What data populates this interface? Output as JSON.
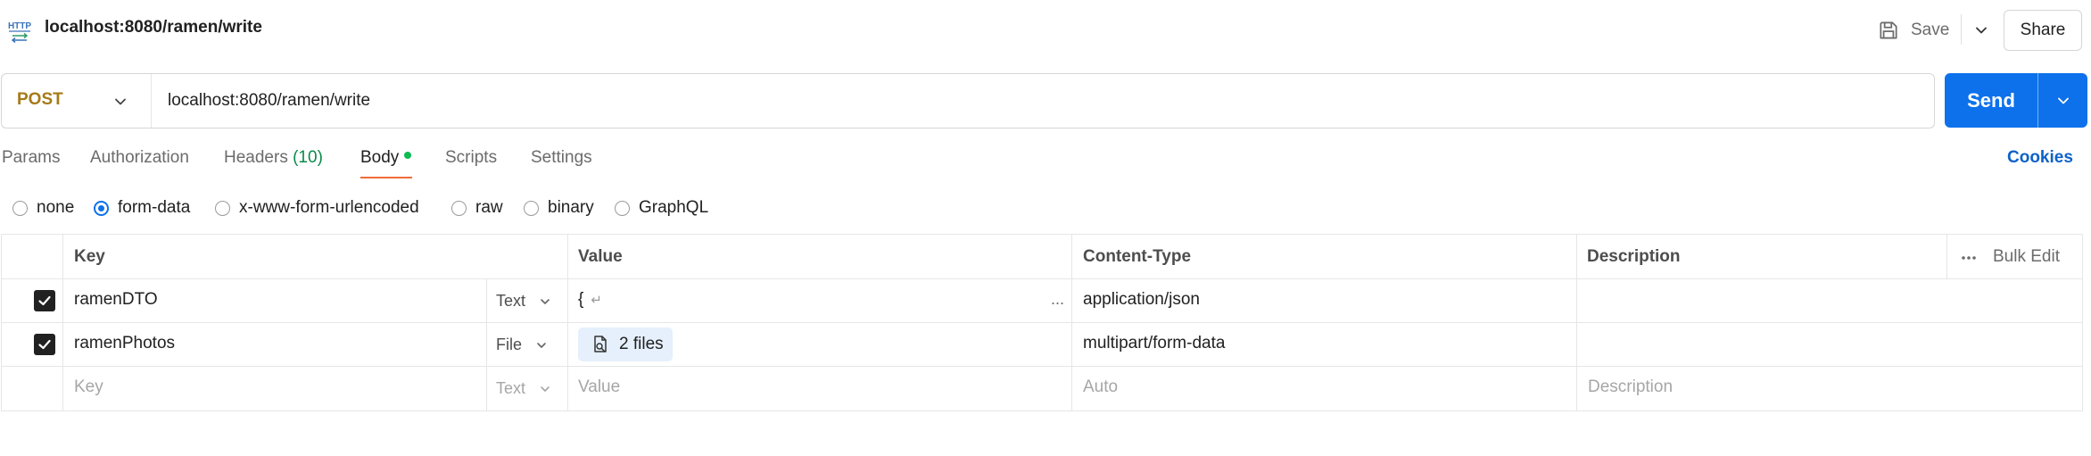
{
  "header": {
    "request_title": "localhost:8080/ramen/write",
    "save_label": "Save",
    "share_label": "Share",
    "http_icon_text": "HTTP"
  },
  "url_bar": {
    "method": "POST",
    "url": "localhost:8080/ramen/write",
    "send_label": "Send"
  },
  "tabs": {
    "items": [
      {
        "label": "Params"
      },
      {
        "label": "Authorization"
      },
      {
        "label": "Headers",
        "count": "(10)"
      },
      {
        "label": "Body"
      },
      {
        "label": "Scripts"
      },
      {
        "label": "Settings"
      }
    ],
    "active": "Body",
    "cookies_label": "Cookies"
  },
  "body_types": {
    "options": [
      "none",
      "form-data",
      "x-www-form-urlencoded",
      "raw",
      "binary",
      "GraphQL"
    ],
    "selected": "form-data"
  },
  "table": {
    "headers": {
      "key": "Key",
      "value": "Value",
      "content_type": "Content-Type",
      "description": "Description",
      "bulk_edit": "Bulk Edit"
    },
    "rows": [
      {
        "checked": true,
        "key": "ramenDTO",
        "type": "Text",
        "value": "{",
        "value_suffix": "↵",
        "overflow": "...",
        "content_type": "application/json",
        "description": ""
      },
      {
        "checked": true,
        "key": "ramenPhotos",
        "type": "File",
        "value": "2 files",
        "content_type": "multipart/form-data",
        "description": ""
      }
    ],
    "placeholder_row": {
      "key": "Key",
      "type": "Text",
      "value": "Value",
      "content_type": "Auto",
      "description": "Description"
    }
  },
  "colors": {
    "send_button": "#0d71eb",
    "method_post": "#a57a17",
    "active_tab_underline": "#f26b3a",
    "body_dot": "#0cbb52",
    "headers_count": "#0c8a4a",
    "cookies_link": "#0d62c8"
  }
}
